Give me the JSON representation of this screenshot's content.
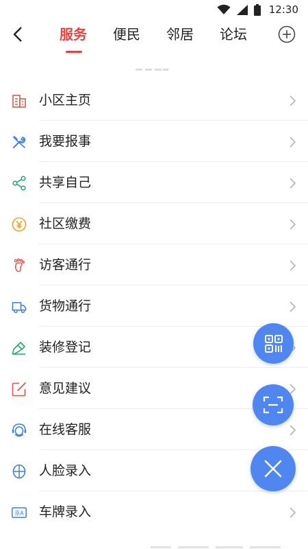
{
  "status_bar": {
    "time": "12:30"
  },
  "nav": {
    "tabs": [
      {
        "label": "服务",
        "active": true
      },
      {
        "label": "便民",
        "active": false
      },
      {
        "label": "邻居",
        "active": false
      },
      {
        "label": "论坛",
        "active": false
      }
    ]
  },
  "menu": {
    "items": [
      {
        "label": "小区主页",
        "icon": "building-icon",
        "color": "#e8534a"
      },
      {
        "label": "我要报事",
        "icon": "tools-icon",
        "color": "#3f7fe0"
      },
      {
        "label": "共享自己",
        "icon": "share-icon",
        "color": "#27a86b"
      },
      {
        "label": "社区缴费",
        "icon": "yen-icon",
        "color": "#f0a020"
      },
      {
        "label": "访客通行",
        "icon": "footprint-icon",
        "color": "#e8534a"
      },
      {
        "label": "货物通行",
        "icon": "truck-icon",
        "color": "#3f7fe0"
      },
      {
        "label": "装修登记",
        "icon": "paint-brush-icon",
        "color": "#27a86b"
      },
      {
        "label": "意见建议",
        "icon": "edit-icon",
        "color": "#e8534a"
      },
      {
        "label": "在线客服",
        "icon": "headset-icon",
        "color": "#3f7fe0"
      },
      {
        "label": "人脸录入",
        "icon": "face-icon",
        "color": "#3f7fe0"
      },
      {
        "label": "车牌录入",
        "icon": "license-plate-icon",
        "color": "#3f7fe0",
        "plate_text": "京A"
      }
    ]
  },
  "colors": {
    "accent": "#e8423f",
    "fab": "#4f86f0"
  }
}
